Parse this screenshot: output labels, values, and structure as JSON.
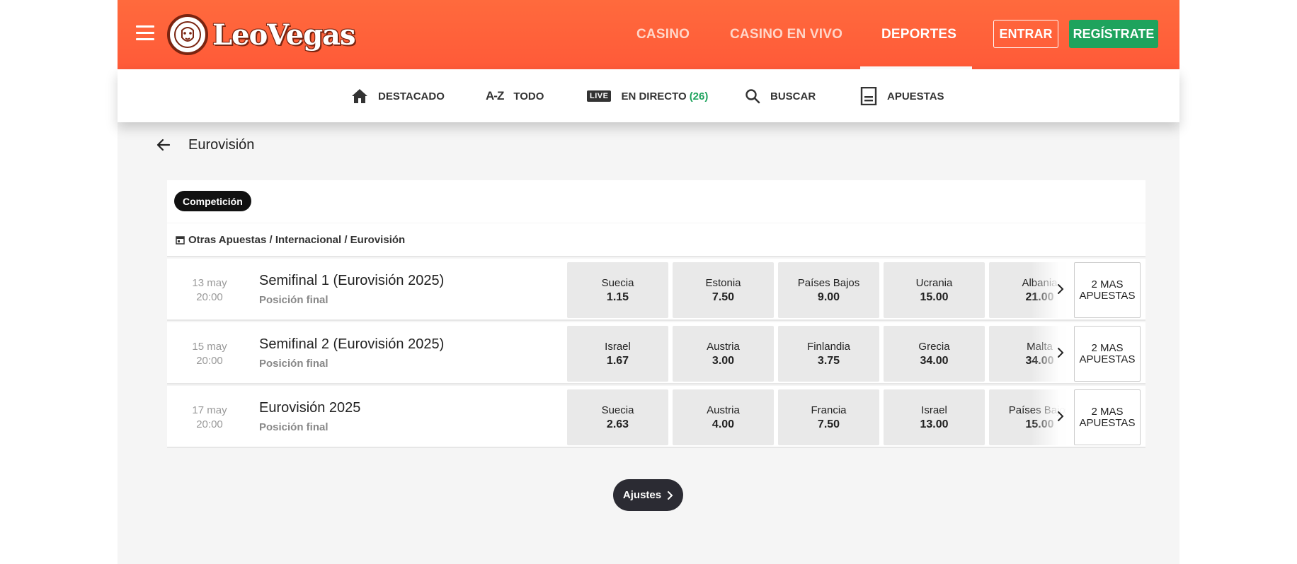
{
  "header": {
    "brand": "LeoVegas",
    "nav": [
      {
        "label": "CASINO",
        "active": false
      },
      {
        "label": "CASINO EN VIVO",
        "active": false
      },
      {
        "label": "DEPORTES",
        "active": true
      }
    ],
    "login_label": "ENTRAR",
    "register_label": "REGÍSTRATE"
  },
  "subnav": {
    "items": [
      {
        "label": "DESTACADO",
        "icon": "home-icon"
      },
      {
        "label": "TODO",
        "icon": "a-z-icon",
        "icon_text": "A-Z"
      },
      {
        "label": "EN DIRECTO",
        "icon": "live-icon",
        "icon_text": "LIVE",
        "count": "(26)"
      },
      {
        "label": "BUSCAR",
        "icon": "search-icon"
      },
      {
        "label": "APUESTAS",
        "icon": "betslip-icon"
      }
    ]
  },
  "page": {
    "title": "Eurovisión",
    "filter_chip": "Competición",
    "breadcrumb": "Otras Apuestas / Internacional / Eurovisión"
  },
  "events": [
    {
      "date": "13 may",
      "time": "20:00",
      "title": "Semifinal 1 (Eurovisión 2025)",
      "market": "Posición final",
      "odds": [
        {
          "name": "Suecia",
          "price": "1.15"
        },
        {
          "name": "Estonia",
          "price": "7.50"
        },
        {
          "name": "Países Bajos",
          "price": "9.00"
        },
        {
          "name": "Ucrania",
          "price": "15.00"
        },
        {
          "name": "Albania",
          "price": "21.00"
        }
      ],
      "more_line1": "2 MAS",
      "more_line2": "APUESTAS"
    },
    {
      "date": "15 may",
      "time": "20:00",
      "title": "Semifinal 2 (Eurovisión 2025)",
      "market": "Posición final",
      "odds": [
        {
          "name": "Israel",
          "price": "1.67"
        },
        {
          "name": "Austria",
          "price": "3.00"
        },
        {
          "name": "Finlandia",
          "price": "3.75"
        },
        {
          "name": "Grecia",
          "price": "34.00"
        },
        {
          "name": "Malta",
          "price": "34.00"
        }
      ],
      "more_line1": "2 MAS",
      "more_line2": "APUESTAS"
    },
    {
      "date": "17 may",
      "time": "20:00",
      "title": "Eurovisión 2025",
      "market": "Posición final",
      "odds": [
        {
          "name": "Suecia",
          "price": "2.63"
        },
        {
          "name": "Austria",
          "price": "4.00"
        },
        {
          "name": "Francia",
          "price": "7.50"
        },
        {
          "name": "Israel",
          "price": "13.00"
        },
        {
          "name": "Países Bajos",
          "price": "15.00"
        }
      ],
      "more_line1": "2 MAS",
      "more_line2": "APUESTAS"
    }
  ],
  "settings_label": "Ajustes",
  "colors": {
    "brand": "#ff5a38",
    "accent_green": "#1ea35d",
    "dark_button": "#2b2b33"
  }
}
